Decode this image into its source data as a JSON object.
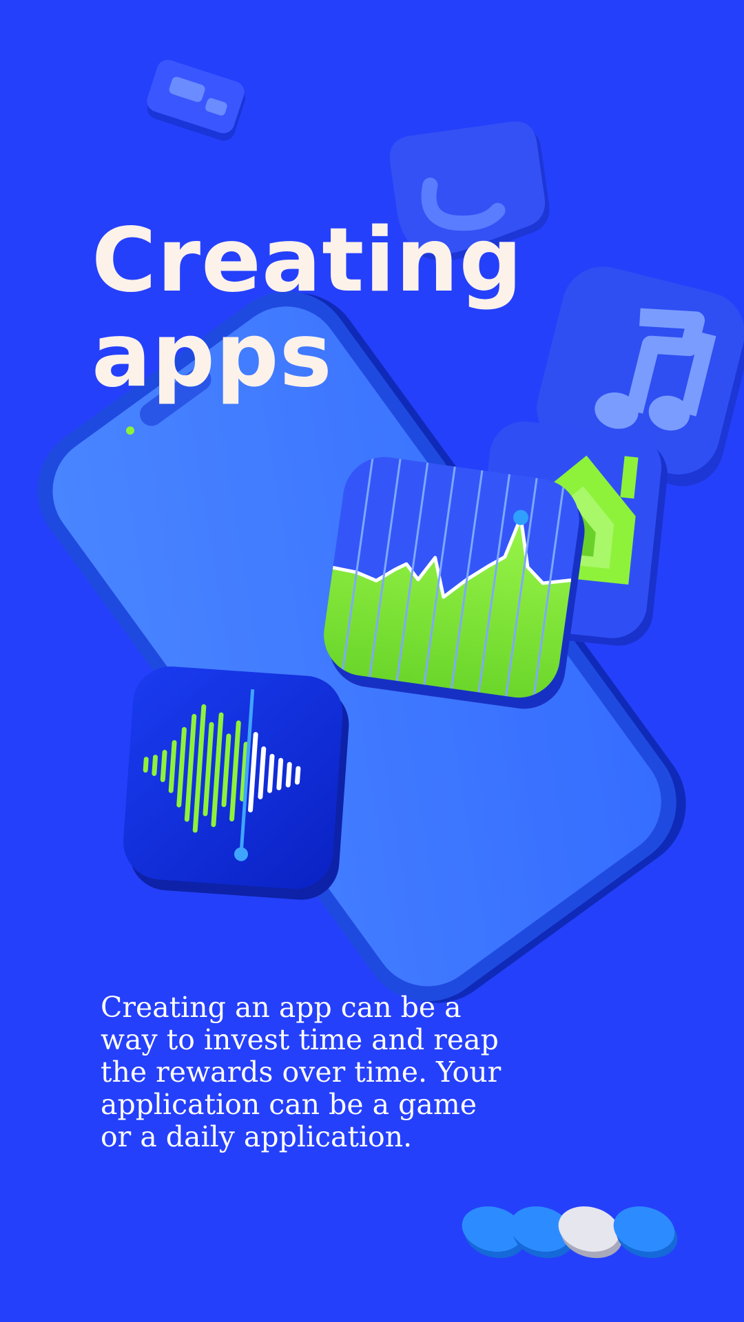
{
  "headline": {
    "line1": "Creating",
    "line2": "apps"
  },
  "body": {
    "lines": [
      "Creating an app can be a",
      "way to invest time and reap",
      "the rewards over time. Your",
      "application can be a game",
      "or a daily application."
    ]
  },
  "pager": {
    "count": 4,
    "active_index": 2
  },
  "colors": {
    "background": "#2540fb",
    "headline_text": "#fdf2ea",
    "accent_green": "#8ef23a",
    "phone_screen": "#3a73ff",
    "dot_active": "#e6e6ee",
    "dot_inactive": "#2c8cff"
  },
  "icons": [
    "message-icon",
    "phone-call-icon",
    "music-note-icon",
    "home-icon",
    "stocks-chart-icon",
    "voice-memo-waveform-icon",
    "smartphone"
  ]
}
